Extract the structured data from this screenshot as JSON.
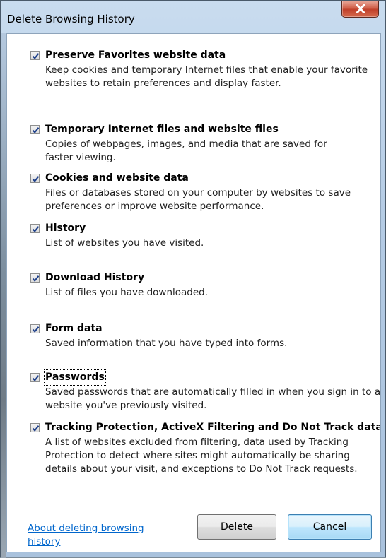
{
  "window": {
    "title": "Delete Browsing History"
  },
  "options": [
    {
      "title": "Preserve Favorites website data",
      "description": "Keep cookies and temporary Internet files that enable your favorite websites to retain preferences and display faster.",
      "checked": true
    },
    {
      "title": "Temporary Internet files and website files",
      "description": "Copies of webpages, images, and media that are saved for faster viewing.",
      "checked": true
    },
    {
      "title": "Cookies and website data",
      "description": "Files or databases stored on your computer by websites to save preferences or improve website performance.",
      "checked": true
    },
    {
      "title": "History",
      "description": "List of websites you have visited.",
      "checked": true
    },
    {
      "title": "Download History",
      "description": "List of files you have downloaded.",
      "checked": true
    },
    {
      "title": "Form data",
      "description": "Saved information that you have typed into forms.",
      "checked": true
    },
    {
      "title": "Passwords",
      "description": "Saved passwords that are automatically filled in when you sign in to a website you've previously visited.",
      "checked": true
    },
    {
      "title": "Tracking Protection, ActiveX Filtering and Do Not Track data",
      "description": "A list of websites excluded from filtering, data used by Tracking Protection to detect where sites might automatically be sharing details about your visit, and exceptions to Do Not Track requests.",
      "checked": true
    }
  ],
  "footer": {
    "about_link": "About deleting browsing history",
    "delete_label": "Delete",
    "cancel_label": "Cancel"
  },
  "colors": {
    "link": "#0066cc",
    "close_button": "#c0402a"
  }
}
